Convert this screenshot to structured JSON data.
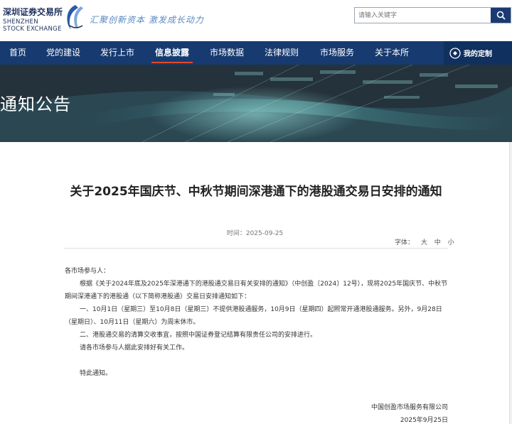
{
  "header": {
    "logo_cn": "深圳证券交易所",
    "logo_en": "SHENZHEN\nSTOCK EXCHANGE",
    "slogan": "汇聚创新资本  激发成长动力",
    "search": {
      "placeholder": "请输入关键字",
      "icon": "search-icon"
    }
  },
  "nav": {
    "items": [
      {
        "label": "首页"
      },
      {
        "label": "党的建设"
      },
      {
        "label": "发行上市"
      },
      {
        "label": "信息披露",
        "active": true
      },
      {
        "label": "市场数据"
      },
      {
        "label": "法律规则"
      },
      {
        "label": "市场服务"
      },
      {
        "label": "关于本所"
      }
    ],
    "custom": {
      "label": "我的定制",
      "icon": "customize-icon"
    },
    "active_color": "#e24a2a",
    "bg_color": "#173a70"
  },
  "banner": {
    "title": "通知公告"
  },
  "article": {
    "title": "关于2025年国庆节、中秋节期间深港通下的港股通交易日安排的通知",
    "time": "时间：2025-09-25",
    "font_size": {
      "label": "字体：",
      "large": "大",
      "medium": "中",
      "small": "小"
    },
    "salutation": "各市场参与人：",
    "paragraphs": [
      "根据《关于2024年底及2025年深港通下的港股通交易日有关安排的通知》（中创盈〔2024〕12号），现将2025年国庆节、中秋节期间深港通下的港股通（以下简称港股通）交易日安排通知如下：",
      "一、10月1日（星期三）至10月8日（星期三）不提供港股通服务，10月9日（星期四）起照常开通港股通服务。另外，9月28日（星期日）、10月11日（星期六）为周末休市。",
      "二、港股通交易的清算交收事宜，按照中国证券登记结算有限责任公司的安排进行。",
      "请各市场参与人据此安排好有关工作。"
    ],
    "closing": "特此通知。",
    "signer": "中国创盈市场服务有限公司",
    "date": "2025年9月25日"
  }
}
